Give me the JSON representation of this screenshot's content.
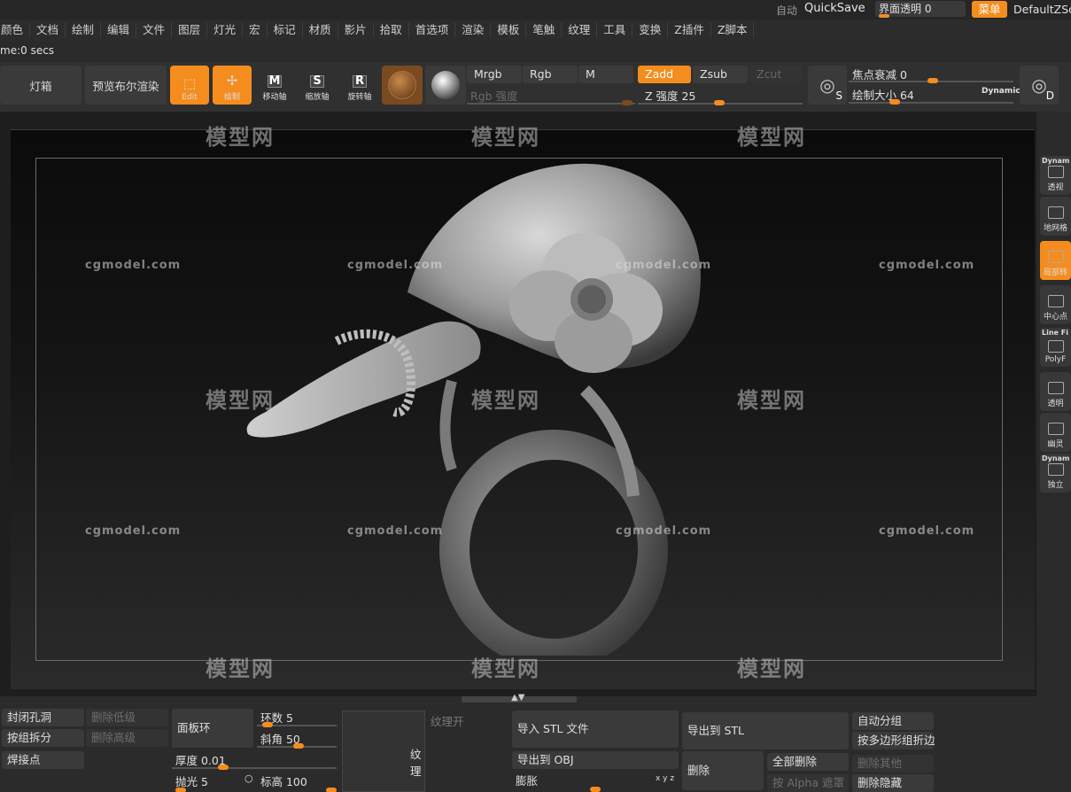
{
  "top": {
    "auto_label": "自动",
    "quicksave_label": "QuickSave",
    "ui_transparency_label": "界面透明 0",
    "menu_label": "菜单",
    "default_script_label": "DefaultZScr"
  },
  "menubar": {
    "items": [
      "颜色",
      "文档",
      "绘制",
      "编辑",
      "文件",
      "图层",
      "灯光",
      "宏",
      "标记",
      "材质",
      "影片",
      "拾取",
      "首选项",
      "渲染",
      "模板",
      "笔触",
      "纹理",
      "工具",
      "变换",
      "Z插件",
      "Z脚本"
    ]
  },
  "timebar": {
    "text": "me:0 secs"
  },
  "toolbar": {
    "lightbox_label": "灯箱",
    "bpr_label": "预览布尔渲染",
    "edit_label": "Edit",
    "draw_label": "绘制",
    "move_label": "移动轴",
    "move_glyph": "M",
    "scale_label": "缩放轴",
    "scale_glyph": "S",
    "rotate_label": "旋转轴",
    "rotate_glyph": "R",
    "mrgb_label": "Mrgb",
    "rgb_label": "Rgb",
    "m_label": "M",
    "zadd_label": "Zadd",
    "zsub_label": "Zsub",
    "zcut_label": "Zcut",
    "rgb_intensity_label": "Rgb 强度",
    "z_intensity_label": "Z 强度 25",
    "z_intensity_value": 25,
    "focal_shift_label": "焦点衰减 0",
    "focal_shift_value": 0,
    "draw_size_label": "绘制大小 64",
    "draw_size_value": 64,
    "dynamic_label": "Dynamic",
    "s_label": "S",
    "d_label": "D"
  },
  "right_shelf": {
    "items": [
      "透视",
      "地网格",
      "局部转",
      "中心点",
      "PolyF",
      "透明",
      "幽灵",
      "独立"
    ],
    "top_labels": [
      "Dynam",
      "Line Fi",
      "Dynam"
    ]
  },
  "watermark": {
    "text": "cgmodel.com",
    "logo": "模型网"
  },
  "bottom": {
    "close_holes": "封闭孔洞",
    "del_lower": "删除低级",
    "split_groups": "按组拆分",
    "del_higher": "删除高级",
    "weld_points": "焊接点",
    "panel_loops": "面板环",
    "loops_label": "环数 5",
    "bevel_label": "斜角 50",
    "thickness_label": "厚度 0.01",
    "polish_label": "抛光 5",
    "elevation_label": "标高 100",
    "texture_on": "纹理开",
    "texture": "纹理",
    "import_stl": "导入 STL 文件",
    "export_stl": "导出到 STL",
    "export_obj": "导出到 OBJ",
    "inflate": "膨胀",
    "xyz": "x y z",
    "delete": "删除",
    "delete_all": "全部删除",
    "by_alpha_mask": "按 Alpha 遮罩",
    "auto_groups": "自动分组",
    "groups_by_polyloop": "按多边形组折边",
    "delete_others": "删除其他",
    "delete_hidden": "删除隐藏"
  }
}
